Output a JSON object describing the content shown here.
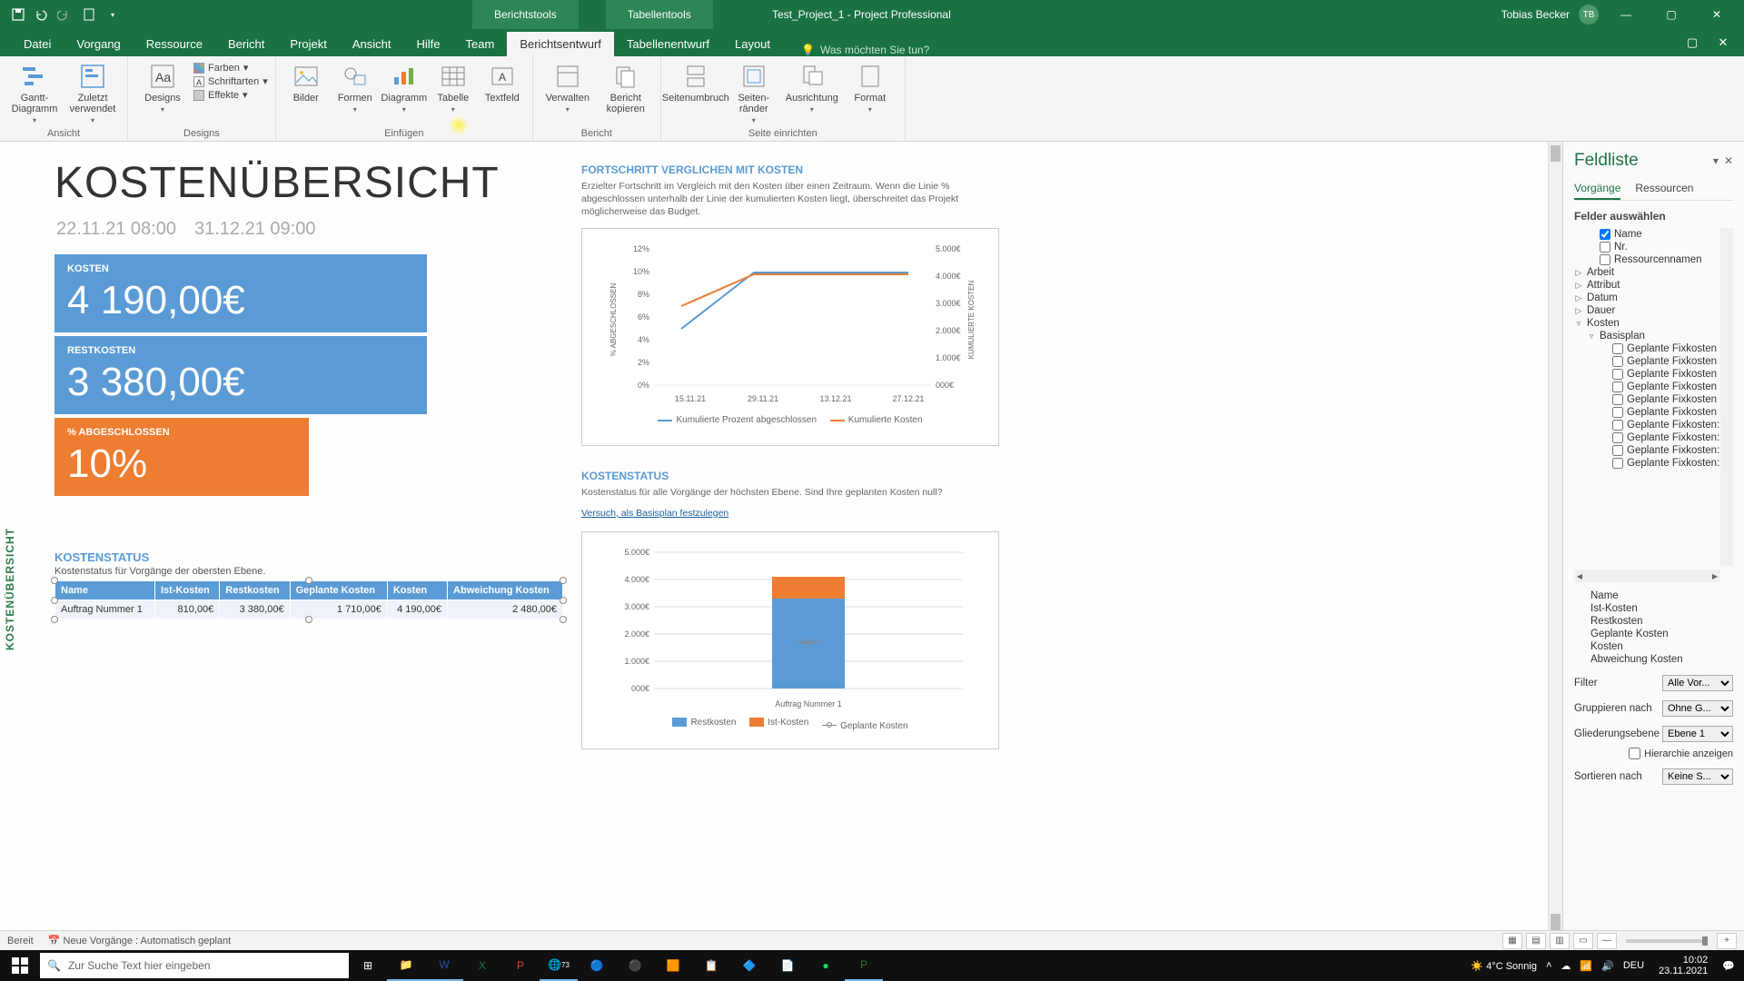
{
  "titlebar": {
    "context_tab1": "Berichtstools",
    "context_tab2": "Tabellentools",
    "doc": "Test_Project_1  -  Project Professional",
    "user": "Tobias Becker",
    "user_initials": "TB"
  },
  "menu": {
    "datei": "Datei",
    "vorgang": "Vorgang",
    "ressource": "Ressource",
    "bericht": "Bericht",
    "projekt": "Projekt",
    "ansicht": "Ansicht",
    "hilfe": "Hilfe",
    "team": "Team",
    "berichtsentwurf": "Berichtsentwurf",
    "tabellenentwurf": "Tabellenentwurf",
    "layout": "Layout",
    "tellme": "Was möchten Sie tun?"
  },
  "ribbon": {
    "group_ansicht": "Ansicht",
    "gantt": "Gantt-Diagramm",
    "zuletzt": "Zuletzt verwendet",
    "group_designs": "Designs",
    "designs": "Designs",
    "farben": "Farben",
    "schriftarten": "Schriftarten",
    "effekte": "Effekte",
    "group_einfuegen": "Einfügen",
    "bilder": "Bilder",
    "formen": "Formen",
    "diagramm": "Diagramm",
    "tabelle": "Tabelle",
    "textfeld": "Textfeld",
    "group_bericht": "Bericht",
    "verwalten": "Verwalten",
    "bericht_kopieren": "Bericht kopieren",
    "group_seite": "Seite einrichten",
    "seitenumbruch": "Seitenumbruch",
    "seitenraender": "Seiten-ränder",
    "ausrichtung": "Ausrichtung",
    "format": "Format"
  },
  "report": {
    "side_label": "KOSTENÜBERSICHT",
    "title": "KOSTENÜBERSICHT",
    "date_from": "22.11.21 08:00",
    "date_to": "31.12.21 09:00",
    "card_kosten_label": "KOSTEN",
    "card_kosten_value": "4 190,00€",
    "card_rest_label": "RESTKOSTEN",
    "card_rest_value": "3 380,00€",
    "card_pct_label": "% ABGESCHLOSSEN",
    "card_pct_value": "10%",
    "kst_title": "KOSTENSTATUS",
    "kst_sub": "Kostenstatus für Vorgänge der obersten Ebene.",
    "table": {
      "h_name": "Name",
      "h_ist": "Ist-Kosten",
      "h_rest": "Restkosten",
      "h_gepl": "Geplante Kosten",
      "h_kosten": "Kosten",
      "h_abw": "Abweichung Kosten",
      "r1_name": "Auftrag Nummer 1",
      "r1_ist": "810,00€",
      "r1_rest": "3 380,00€",
      "r1_gepl": "1 710,00€",
      "r1_kosten": "4 190,00€",
      "r1_abw": "2 480,00€"
    }
  },
  "chart1": {
    "title": "FORTSCHRITT VERGLICHEN MIT KOSTEN",
    "desc": "Erzielter Fortschritt im Vergleich mit den Kosten über einen Zeitraum. Wenn die Linie % abgeschlossen unterhalb der Linie der kumulierten Kosten liegt, überschreitet das Projekt möglicherweise das Budget.",
    "legend_a": "Kumulierte Prozent abgeschlossen",
    "legend_b": "Kumulierte Kosten",
    "ylabel_left": "% ABGESCHLOSSEN",
    "ylabel_right": "KUMULIERTE KOSTEN",
    "x": [
      "15.11.21",
      "29.11.21",
      "13.12.21",
      "27.12.21"
    ],
    "yl": [
      "0%",
      "2%",
      "4%",
      "6%",
      "8%",
      "10%",
      "12%"
    ],
    "yr": [
      "000€",
      "1.000€",
      "2.000€",
      "3.000€",
      "4.000€",
      "5.000€"
    ]
  },
  "chart2": {
    "title": "KOSTENSTATUS",
    "desc": "Kostenstatus für alle Vorgänge der höchsten Ebene. Sind Ihre geplanten Kosten null?",
    "link": "Versuch, als Basisplan festzulegen",
    "y": [
      "000€",
      "1.000€",
      "2.000€",
      "3.000€",
      "4.000€",
      "5.000€"
    ],
    "xcat": "Auftrag Nummer 1",
    "legend_rest": "Restkosten",
    "legend_ist": "Ist-Kosten",
    "legend_gepl": "Geplante Kosten"
  },
  "chart_data": [
    {
      "type": "line",
      "title": "Fortschritt verglichen mit Kosten",
      "x": [
        "15.11.21",
        "29.11.21",
        "13.12.21",
        "27.12.21"
      ],
      "series": [
        {
          "name": "Kumulierte Prozent abgeschlossen",
          "axis": "left",
          "unit": "%",
          "values": [
            5,
            10,
            10,
            10
          ]
        },
        {
          "name": "Kumulierte Kosten",
          "axis": "right",
          "unit": "€",
          "values": [
            3000,
            4190,
            4190,
            4190
          ]
        }
      ],
      "y_left": {
        "label": "% ABGESCHLOSSEN",
        "range": [
          0,
          12
        ]
      },
      "y_right": {
        "label": "KUMULIERTE KOSTEN",
        "range": [
          0,
          5000
        ]
      }
    },
    {
      "type": "bar",
      "title": "Kostenstatus",
      "categories": [
        "Auftrag Nummer 1"
      ],
      "series": [
        {
          "name": "Restkosten",
          "values": [
            3380
          ],
          "color": "#5b9bd5"
        },
        {
          "name": "Ist-Kosten",
          "values": [
            810
          ],
          "color": "#ed7d31"
        },
        {
          "name": "Geplante Kosten",
          "values": [
            1710
          ],
          "type": "line-marker",
          "color": "#888"
        }
      ],
      "ylim": [
        0,
        5000
      ],
      "ylabel": "€"
    }
  ],
  "fieldlist": {
    "title": "Feldliste",
    "tab_vorg": "Vorgänge",
    "tab_res": "Ressourcen",
    "sub": "Felder auswählen",
    "name": "Name",
    "nr": "Nr.",
    "resn": "Ressourcennamen",
    "arbeit": "Arbeit",
    "attribut": "Attribut",
    "datum": "Datum",
    "dauer": "Dauer",
    "kosten": "Kosten",
    "basisplan": "Basisplan",
    "gfk": "Geplante Fixkosten",
    "gfka": "Geplante Fixkosten:",
    "sel_name": "Name",
    "sel_ist": "Ist-Kosten",
    "sel_rest": "Restkosten",
    "sel_gepl": "Geplante Kosten",
    "sel_kosten": "Kosten",
    "sel_abw": "Abweichung Kosten",
    "filter_lbl": "Filter",
    "filter_v": "Alle Vor...",
    "group_lbl": "Gruppieren nach",
    "group_v": "Ohne G...",
    "outline_lbl": "Gliederungsebene",
    "outline_v": "Ebene 1",
    "hier": "Hierarchie anzeigen",
    "sort_lbl": "Sortieren nach",
    "sort_v": "Keine S..."
  },
  "status": {
    "ready": "Bereit",
    "newtasks": "Neue Vorgänge : Automatisch geplant"
  },
  "taskbar": {
    "search": "Zur Suche Text hier eingeben",
    "weather": "4°C  Sonnig",
    "lang": "DEU",
    "time": "10:02",
    "date": "23.11.2021"
  }
}
